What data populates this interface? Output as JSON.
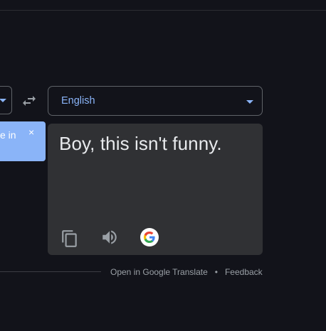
{
  "source": {
    "text_snippet": "e in",
    "clear_label": "×"
  },
  "target": {
    "language": "English"
  },
  "result": {
    "text": "Boy, this isn't funny."
  },
  "footer": {
    "open_link": "Open in Google Translate",
    "separator": "•",
    "feedback_link": "Feedback"
  },
  "colors": {
    "background": "#12131a",
    "accent": "#8ab4f8",
    "card": "#303134",
    "text": "#e8eaed",
    "muted": "#9aa0a6"
  },
  "icons": [
    "swap-icon",
    "copy-icon",
    "speaker-icon",
    "google-icon",
    "chevron-down-icon",
    "close-icon"
  ]
}
